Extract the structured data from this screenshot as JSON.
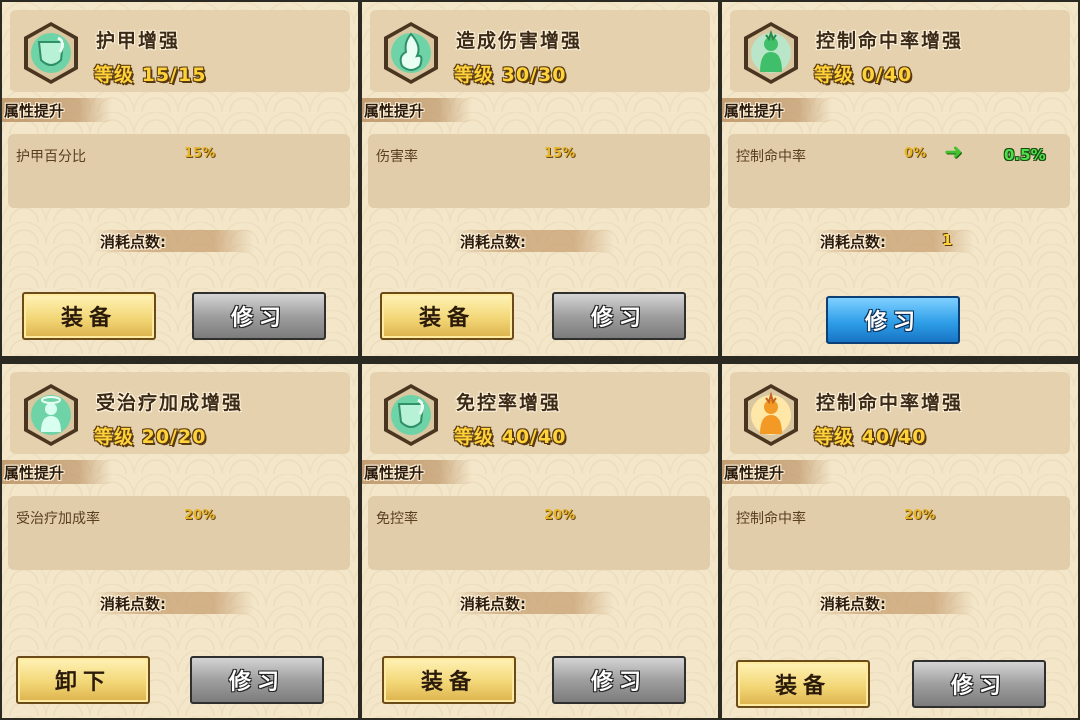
{
  "colors": {
    "panel_bg": "#f3e6c9",
    "level_gold": "#ffd23a",
    "value_gold": "#e6b428",
    "new_value_green": "#4ee04a",
    "button_gold": "#f3d777",
    "button_gray": "#9f9f9f",
    "button_blue": "#2f9fe8"
  },
  "panels": [
    {
      "icon": "shield-leaf-icon",
      "title": "护甲增强",
      "level": "等级 15/15",
      "section_label": "属性提升",
      "attr_name": "护甲百分比",
      "attr_value": "15%",
      "cost_label": "消耗点数:",
      "btn_primary": "装备",
      "btn_secondary": "修习"
    },
    {
      "icon": "flame-spirit-icon",
      "title": "造成伤害增强",
      "level": "等级 30/30",
      "section_label": "属性提升",
      "attr_name": "伤害率",
      "attr_value": "15%",
      "cost_label": "消耗点数:",
      "btn_primary": "装备",
      "btn_secondary": "修习"
    },
    {
      "icon": "green-figure-icon",
      "title": "控制命中率增强",
      "level": "等级 0/40",
      "section_label": "属性提升",
      "attr_name": "控制命中率",
      "attr_value": "0%",
      "attr_arrow": "➜",
      "attr_new_value": "0.5%",
      "cost_label": "消耗点数:",
      "cost_value": "1",
      "btn_single": "修习"
    },
    {
      "icon": "halo-figure-icon",
      "title": "受治疗加成增强",
      "level": "等级 20/20",
      "section_label": "属性提升",
      "attr_name": "受治疗加成率",
      "attr_value": "20%",
      "cost_label": "消耗点数:",
      "btn_primary": "卸下",
      "btn_secondary": "修习"
    },
    {
      "icon": "shield-leaf-icon",
      "title": "免控率增强",
      "level": "等级 40/40",
      "section_label": "属性提升",
      "attr_name": "免控率",
      "attr_value": "20%",
      "cost_label": "消耗点数:",
      "btn_primary": "装备",
      "btn_secondary": "修习"
    },
    {
      "icon": "orange-figure-icon",
      "title": "控制命中率增强",
      "level": "等级 40/40",
      "section_label": "属性提升",
      "attr_name": "控制命中率",
      "attr_value": "20%",
      "cost_label": "消耗点数:",
      "btn_primary": "装备",
      "btn_secondary": "修习"
    }
  ]
}
